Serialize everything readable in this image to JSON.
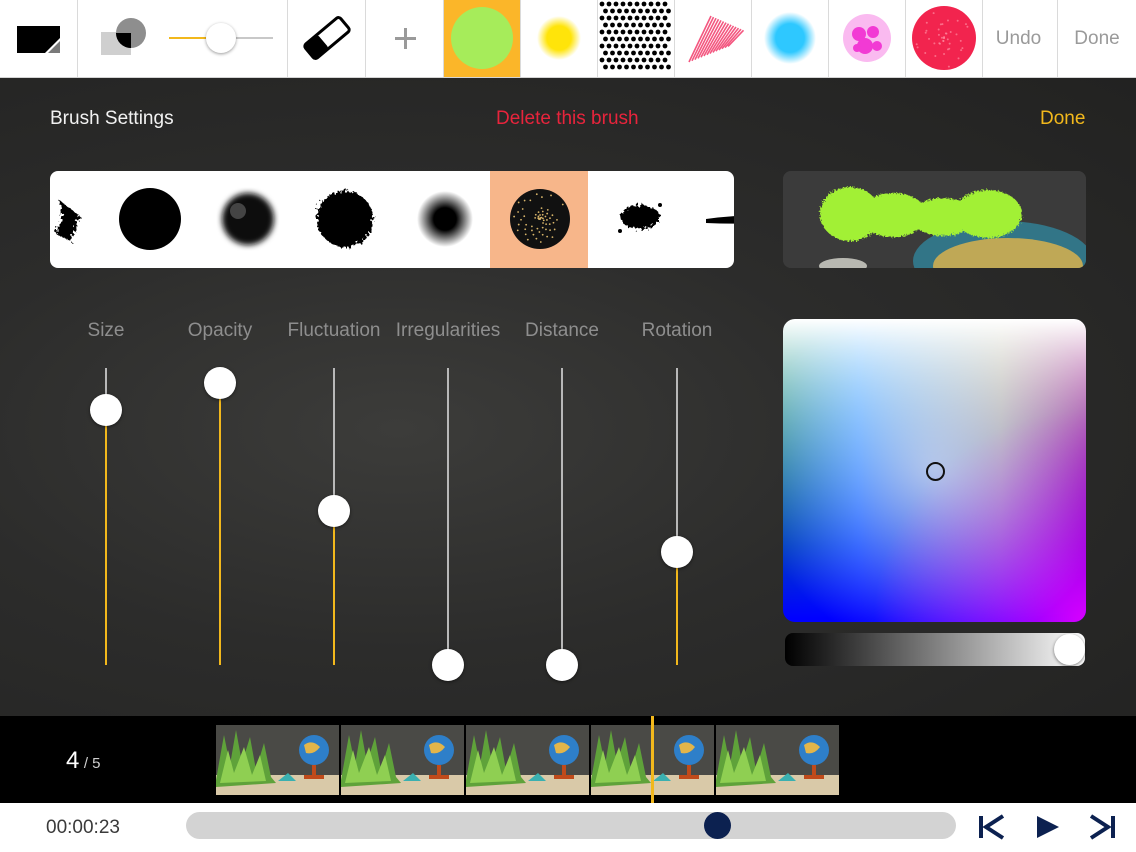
{
  "toolbar": {
    "undo_label": "Undo",
    "done_label": "Done",
    "size_slider_value": 0.5,
    "brush_presets": [
      {
        "name": "lime-fill-brush",
        "color": "#a6ec5a",
        "selected": true
      },
      {
        "name": "yellow-airbrush",
        "color": "#ffe40a"
      },
      {
        "name": "dot-pattern-brush",
        "color": "#000000"
      },
      {
        "name": "pink-pencil-brush",
        "color": "#f23a6a"
      },
      {
        "name": "cyan-airbrush",
        "color": "#2ec8ff"
      },
      {
        "name": "magenta-spray-brush",
        "color": "#f23ad4"
      },
      {
        "name": "red-noise-brush",
        "color": "#f2244e"
      }
    ],
    "selected_bg": "#fbb629"
  },
  "panel": {
    "title": "Brush Settings",
    "delete_label": "Delete this brush",
    "done_label": "Done",
    "delete_color": "#e8243c",
    "done_color": "#f2b81c",
    "brush_shapes": [
      "ragged",
      "hard-round",
      "soft-clump",
      "rough-charcoal",
      "soft-round",
      "speckled-round",
      "splatter",
      "stroke-tip"
    ],
    "selected_brush_index": 5,
    "preview_color": "#a2f036",
    "sliders": [
      {
        "label": "Size",
        "value": 0.86
      },
      {
        "label": "Opacity",
        "value": 0.95
      },
      {
        "label": "Fluctuation",
        "value": 0.52
      },
      {
        "label": "Irregularities",
        "value": 0.0
      },
      {
        "label": "Distance",
        "value": 0.0
      },
      {
        "label": "Rotation",
        "value": 0.38
      }
    ],
    "accent_color": "#f2b81c",
    "color_picker": {
      "cursor_x": 0.5,
      "cursor_y": 0.5,
      "brightness": 0.95
    }
  },
  "timeline": {
    "frame_current": "4",
    "frame_total": "/ 5",
    "thumbnail_count": 5
  },
  "bottombar": {
    "timecode": "00:00:23",
    "progress": 0.69
  }
}
